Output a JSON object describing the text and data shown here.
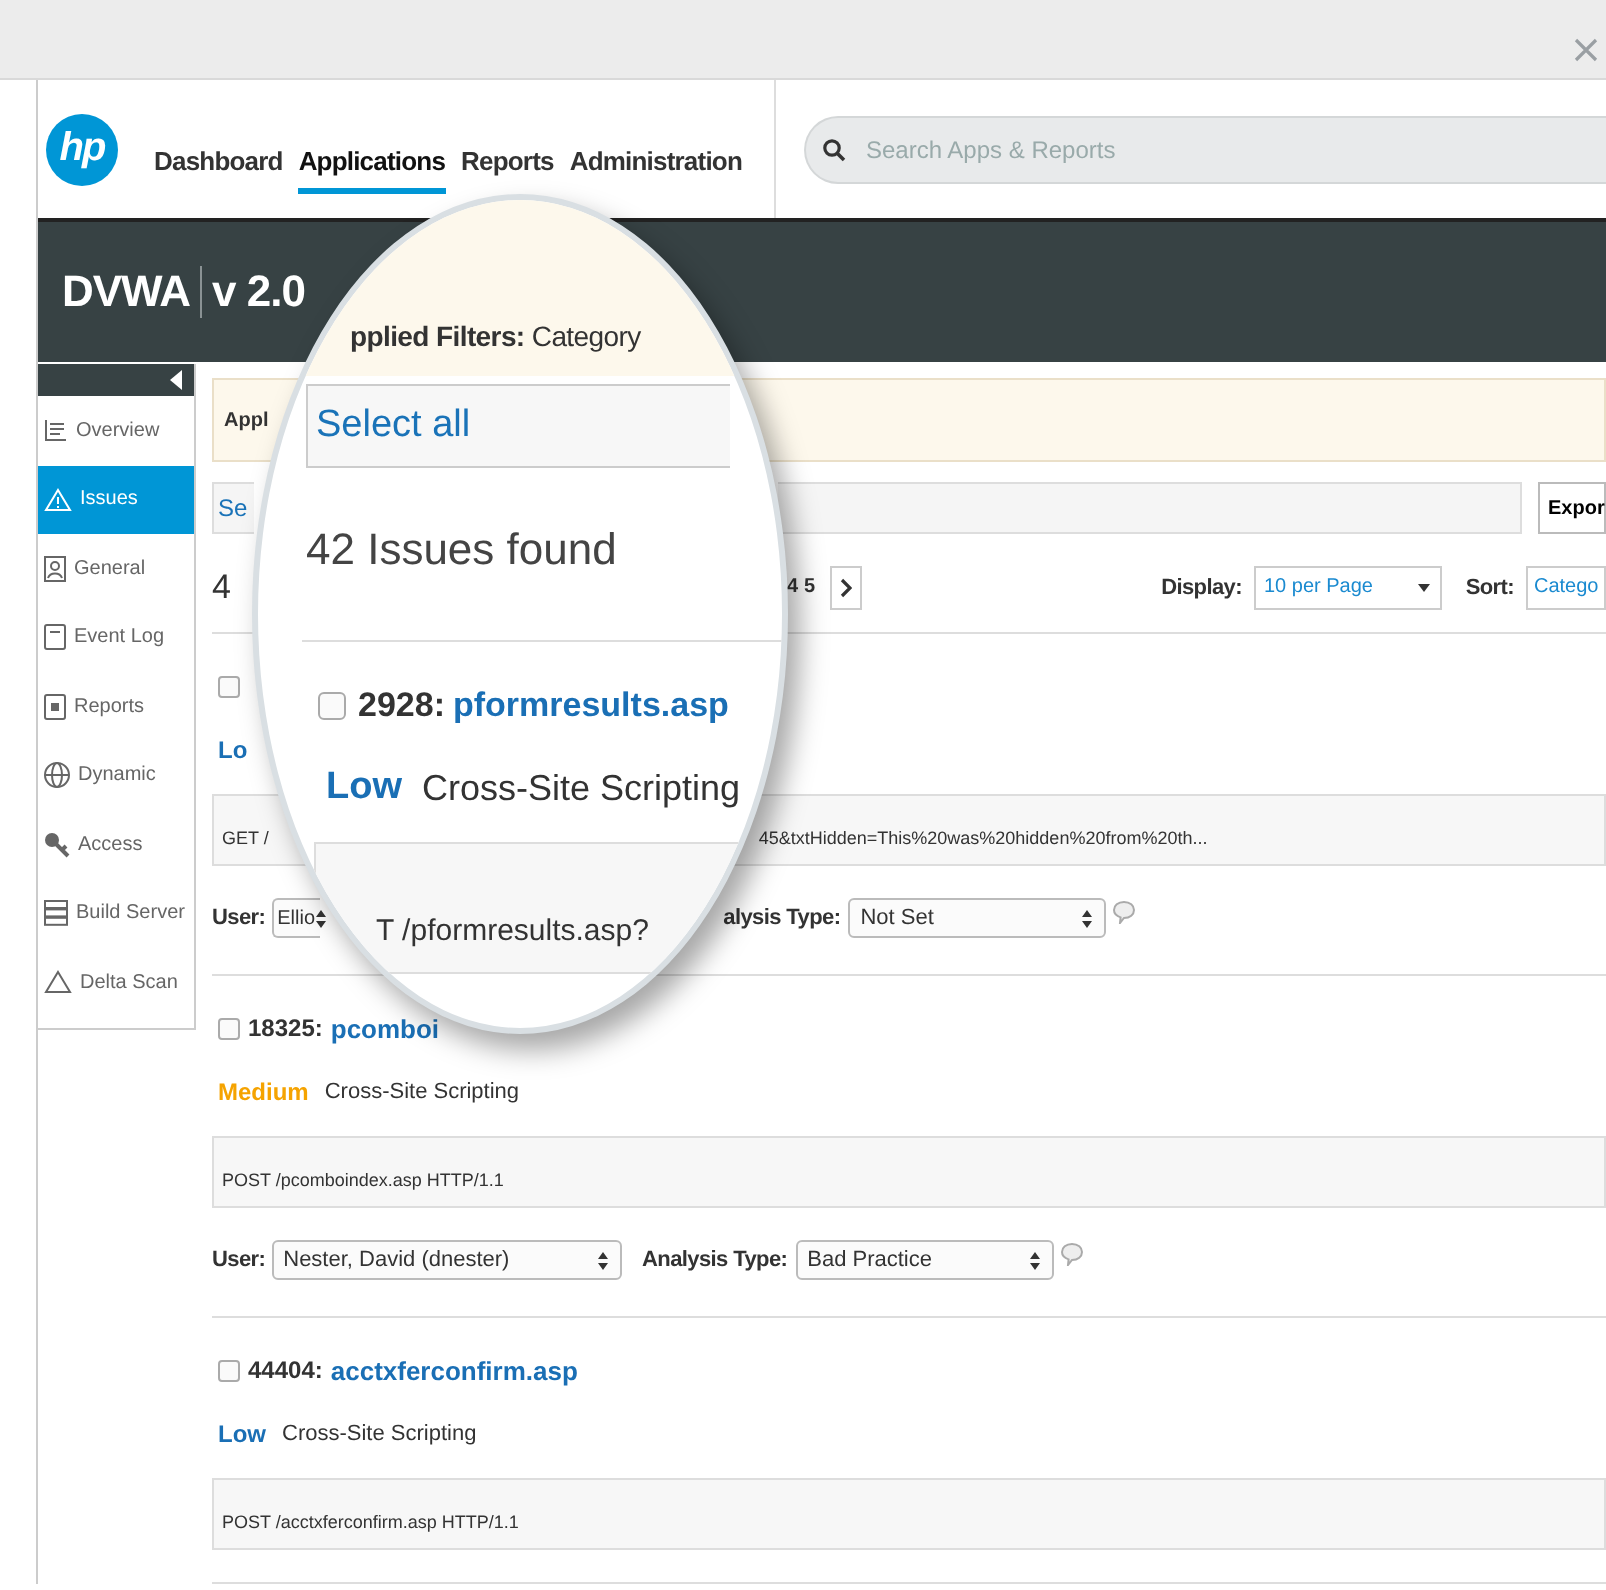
{
  "logo": "hp",
  "nav": [
    {
      "label": "Dashboard",
      "selected": false
    },
    {
      "label": "Applications",
      "selected": true
    },
    {
      "label": "Reports",
      "selected": false
    },
    {
      "label": "Administration",
      "selected": false
    }
  ],
  "search": {
    "placeholder": "Search Apps & Reports"
  },
  "app": {
    "name": "DVWA",
    "version": "v 2.0"
  },
  "sidebar": {
    "items": [
      {
        "label": "Overview",
        "selected": false
      },
      {
        "label": "Issues",
        "selected": true
      },
      {
        "label": "General",
        "selected": false
      },
      {
        "label": "Event Log",
        "selected": false
      },
      {
        "label": "Reports",
        "selected": false
      },
      {
        "label": "Dynamic",
        "selected": false
      },
      {
        "label": "Access",
        "selected": false
      },
      {
        "label": "Build Server",
        "selected": false
      },
      {
        "label": "Delta Scan",
        "selected": false
      }
    ]
  },
  "filter_bar": {
    "text": "Appl"
  },
  "search_row": {
    "text": "Se",
    "export": "Expor"
  },
  "pager": {
    "count": "4",
    "pages": [
      "4",
      "5"
    ],
    "display_label": "Display:",
    "display_value": "10 per Page",
    "sort_label": "Sort:",
    "sort_value": "Catego"
  },
  "issues": [
    {
      "checked": false,
      "severity": "Lo",
      "color": "#1a6fb5",
      "request": "GET /",
      "request_tail": "45&txtHidden=This%20was%20hidden%20from%20th...",
      "user_label": "User:",
      "user": "Ellio",
      "analysis_label": "alysis Type:",
      "analysis": "Not Set"
    },
    {
      "checked": false,
      "id": "18325:",
      "name": "pcomboi",
      "severity": "Medium",
      "color": "#f5a300",
      "category": "Cross-Site Scripting",
      "request": "POST /pcomboindex.asp HTTP/1.1",
      "user_label": "User:",
      "user": "Nester, David (dnester)",
      "analysis_label": "Analysis Type:",
      "analysis": "Bad Practice"
    },
    {
      "checked": false,
      "id": "44404:",
      "name": "acctxferconfirm.asp",
      "severity": "Low",
      "color": "#1a6fb5",
      "category": "Cross-Site Scripting",
      "request": "POST /acctxferconfirm.asp HTTP/1.1"
    }
  ],
  "lens": {
    "filter_label": "pplied Filters:",
    "filter_value": "Category",
    "select_all": "Select all",
    "count": "42 Issues found",
    "issue": {
      "checked": false,
      "id": "2928:",
      "name": "pformresults.asp",
      "severity": "Low",
      "color": "#1a6fb5",
      "category": "Cross-Site Scripting",
      "request": "T /pformresults.asp?"
    }
  }
}
